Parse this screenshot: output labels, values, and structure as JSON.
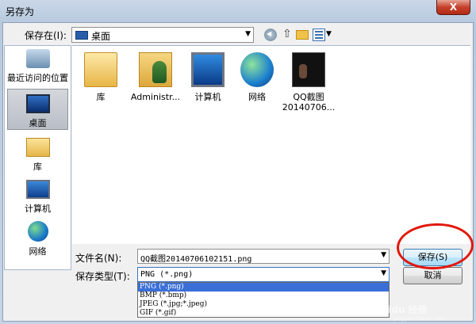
{
  "window": {
    "title": "另存为",
    "close_glyph": "X"
  },
  "toolbar": {
    "save_in_label": "保存在(I):",
    "location": "桌面",
    "icons": [
      "back-icon",
      "up-folder-icon",
      "new-folder-icon",
      "view-menu-icon"
    ]
  },
  "places": [
    {
      "label": "最近访问的位置",
      "icon": "recent-places-icon"
    },
    {
      "label": "桌面",
      "icon": "desktop-icon",
      "selected": true
    },
    {
      "label": "库",
      "icon": "library-icon"
    },
    {
      "label": "计算机",
      "icon": "computer-icon"
    },
    {
      "label": "网络",
      "icon": "network-icon"
    }
  ],
  "files": [
    {
      "label": "库",
      "icon": "library-folder-icon"
    },
    {
      "label": "Administr...",
      "icon": "user-folder-icon"
    },
    {
      "label": "计算机",
      "icon": "computer-icon"
    },
    {
      "label": "网络",
      "icon": "network-icon"
    },
    {
      "label": "QQ截图20140706...",
      "label_line1": "QQ截图",
      "label_line2": "20140706...",
      "icon": "image-thumbnail"
    }
  ],
  "form": {
    "filename_label": "文件名(N):",
    "filename_value": "QQ截图20140706102151.png",
    "filetype_label": "保存类型(T):",
    "filetype_value": "PNG (*.png)",
    "filetype_options": [
      "PNG (*.png)",
      "BMP (*.bmp)",
      "JPEG (*.jpg;*.jpeg)",
      "GIF (*.gif)"
    ]
  },
  "buttons": {
    "save": "保存(S)",
    "cancel": "取消"
  },
  "watermark": {
    "brand": "Baidu 经验",
    "url": "jingyan.baidu.com"
  },
  "colors": {
    "highlight": "#e2180c",
    "selection": "#3a6fd8"
  }
}
